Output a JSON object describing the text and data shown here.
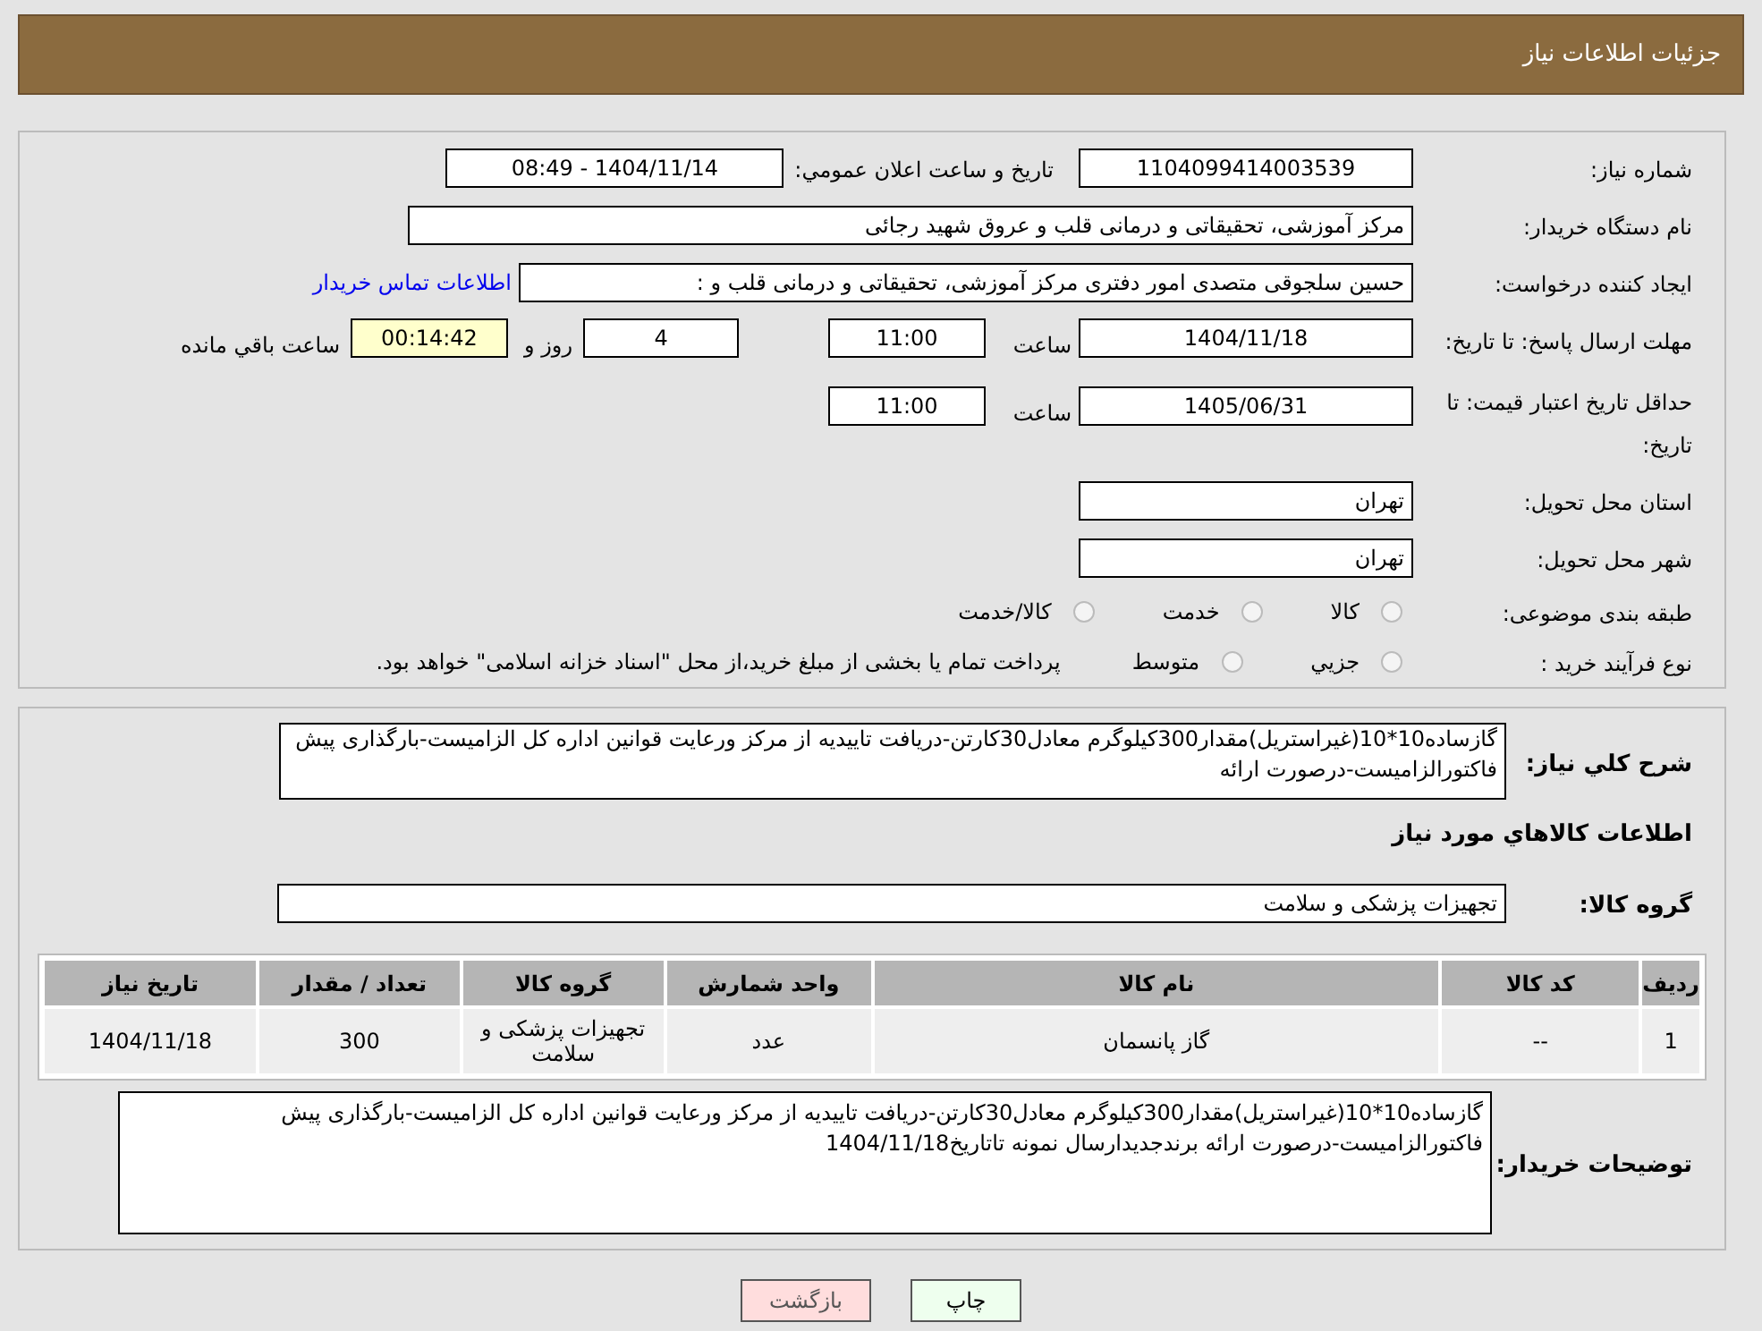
{
  "header": {
    "title": "جزئیات اطلاعات نیاز"
  },
  "need_number": {
    "label": "شماره نیاز:",
    "value": "1104099414003539"
  },
  "announce": {
    "label": "تاريخ و ساعت اعلان عمومي:",
    "value": "1404/11/14 - 08:49"
  },
  "buyer": {
    "label": "نام دستگاه خریدار:",
    "value": "مرکز آموزشی، تحقیقاتی و درمانی قلب و عروق شهید رجائی"
  },
  "creator": {
    "label": "ایجاد کننده درخواست:",
    "value": "حسین سلجوقی متصدی امور دفتری مرکز آموزشی، تحقیقاتی و درمانی قلب و :",
    "link": "اطلاعات تماس خریدار"
  },
  "reply_deadline": {
    "label": "مهلت ارسال پاسخ: تا تاريخ:",
    "date": "1404/11/18",
    "time_label": "ساعت",
    "time": "11:00",
    "days": "4",
    "days_label": "روز و",
    "remaining": "00:14:42",
    "remaining_label": "ساعت باقي مانده"
  },
  "price_validity": {
    "label": "حداقل تاريخ اعتبار قیمت: تا تاريخ:",
    "date": "1405/06/31",
    "time_label": "ساعت",
    "time": "11:00"
  },
  "province": {
    "label": "استان محل تحویل:",
    "value": "تهران"
  },
  "city": {
    "label": "شهر محل تحویل:",
    "value": "تهران"
  },
  "category": {
    "label": "طبقه بندی موضوعی:",
    "options": [
      {
        "label": "کالا",
        "selected": false
      },
      {
        "label": "خدمت",
        "selected": false
      },
      {
        "label": "کالا/خدمت",
        "selected": false
      }
    ]
  },
  "purchase_type": {
    "label": "نوع فرآیند خرید :",
    "options": [
      {
        "label": "جزيي",
        "selected": false
      },
      {
        "label": "متوسط",
        "selected": false
      }
    ],
    "note": "پرداخت تمام یا بخشی از مبلغ خرید،از محل \"اسناد خزانه اسلامی\" خواهد بود."
  },
  "description": {
    "label": "شرح کلي نیاز:",
    "value": "گازساده10*10(غیراستریل)مقدار300کیلوگرم معادل30کارتن-دریافت تاییدیه از مرکز ورعایت قوانین اداره کل الزامیست-بارگذاری پیش فاکتورالزامیست-درصورت ارائه"
  },
  "goods_heading": "اطلاعات کالاهاي مورد نیاز",
  "goods_group": {
    "label": "گروه کالا:",
    "value": "تجهیزات پزشکی و سلامت"
  },
  "table": {
    "columns": [
      "ردیف",
      "کد کالا",
      "نام کالا",
      "واحد شمارش",
      "گروه کالا",
      "تعداد / مقدار",
      "تاریخ نیاز"
    ],
    "rows": [
      [
        "1",
        "--",
        "گاز پانسمان",
        "عدد",
        "تجهیزات پزشکی و سلامت",
        "300",
        "1404/11/18"
      ]
    ]
  },
  "buyer_notes": {
    "label": "توضیحات خریدار:",
    "value": "گازساده10*10(غیراستریل)مقدار300کیلوگرم معادل30کارتن-دریافت تاییدیه از مرکز ورعایت قوانین اداره کل الزامیست-بارگذاری پیش فاکتورالزامیست-درصورت ارائه برندجدیدارسال نمونه تاتاریخ1404/11/18"
  },
  "buttons": [
    {
      "label": "چاپ",
      "kind": "print"
    },
    {
      "label": "بازگشت",
      "kind": "back"
    }
  ]
}
